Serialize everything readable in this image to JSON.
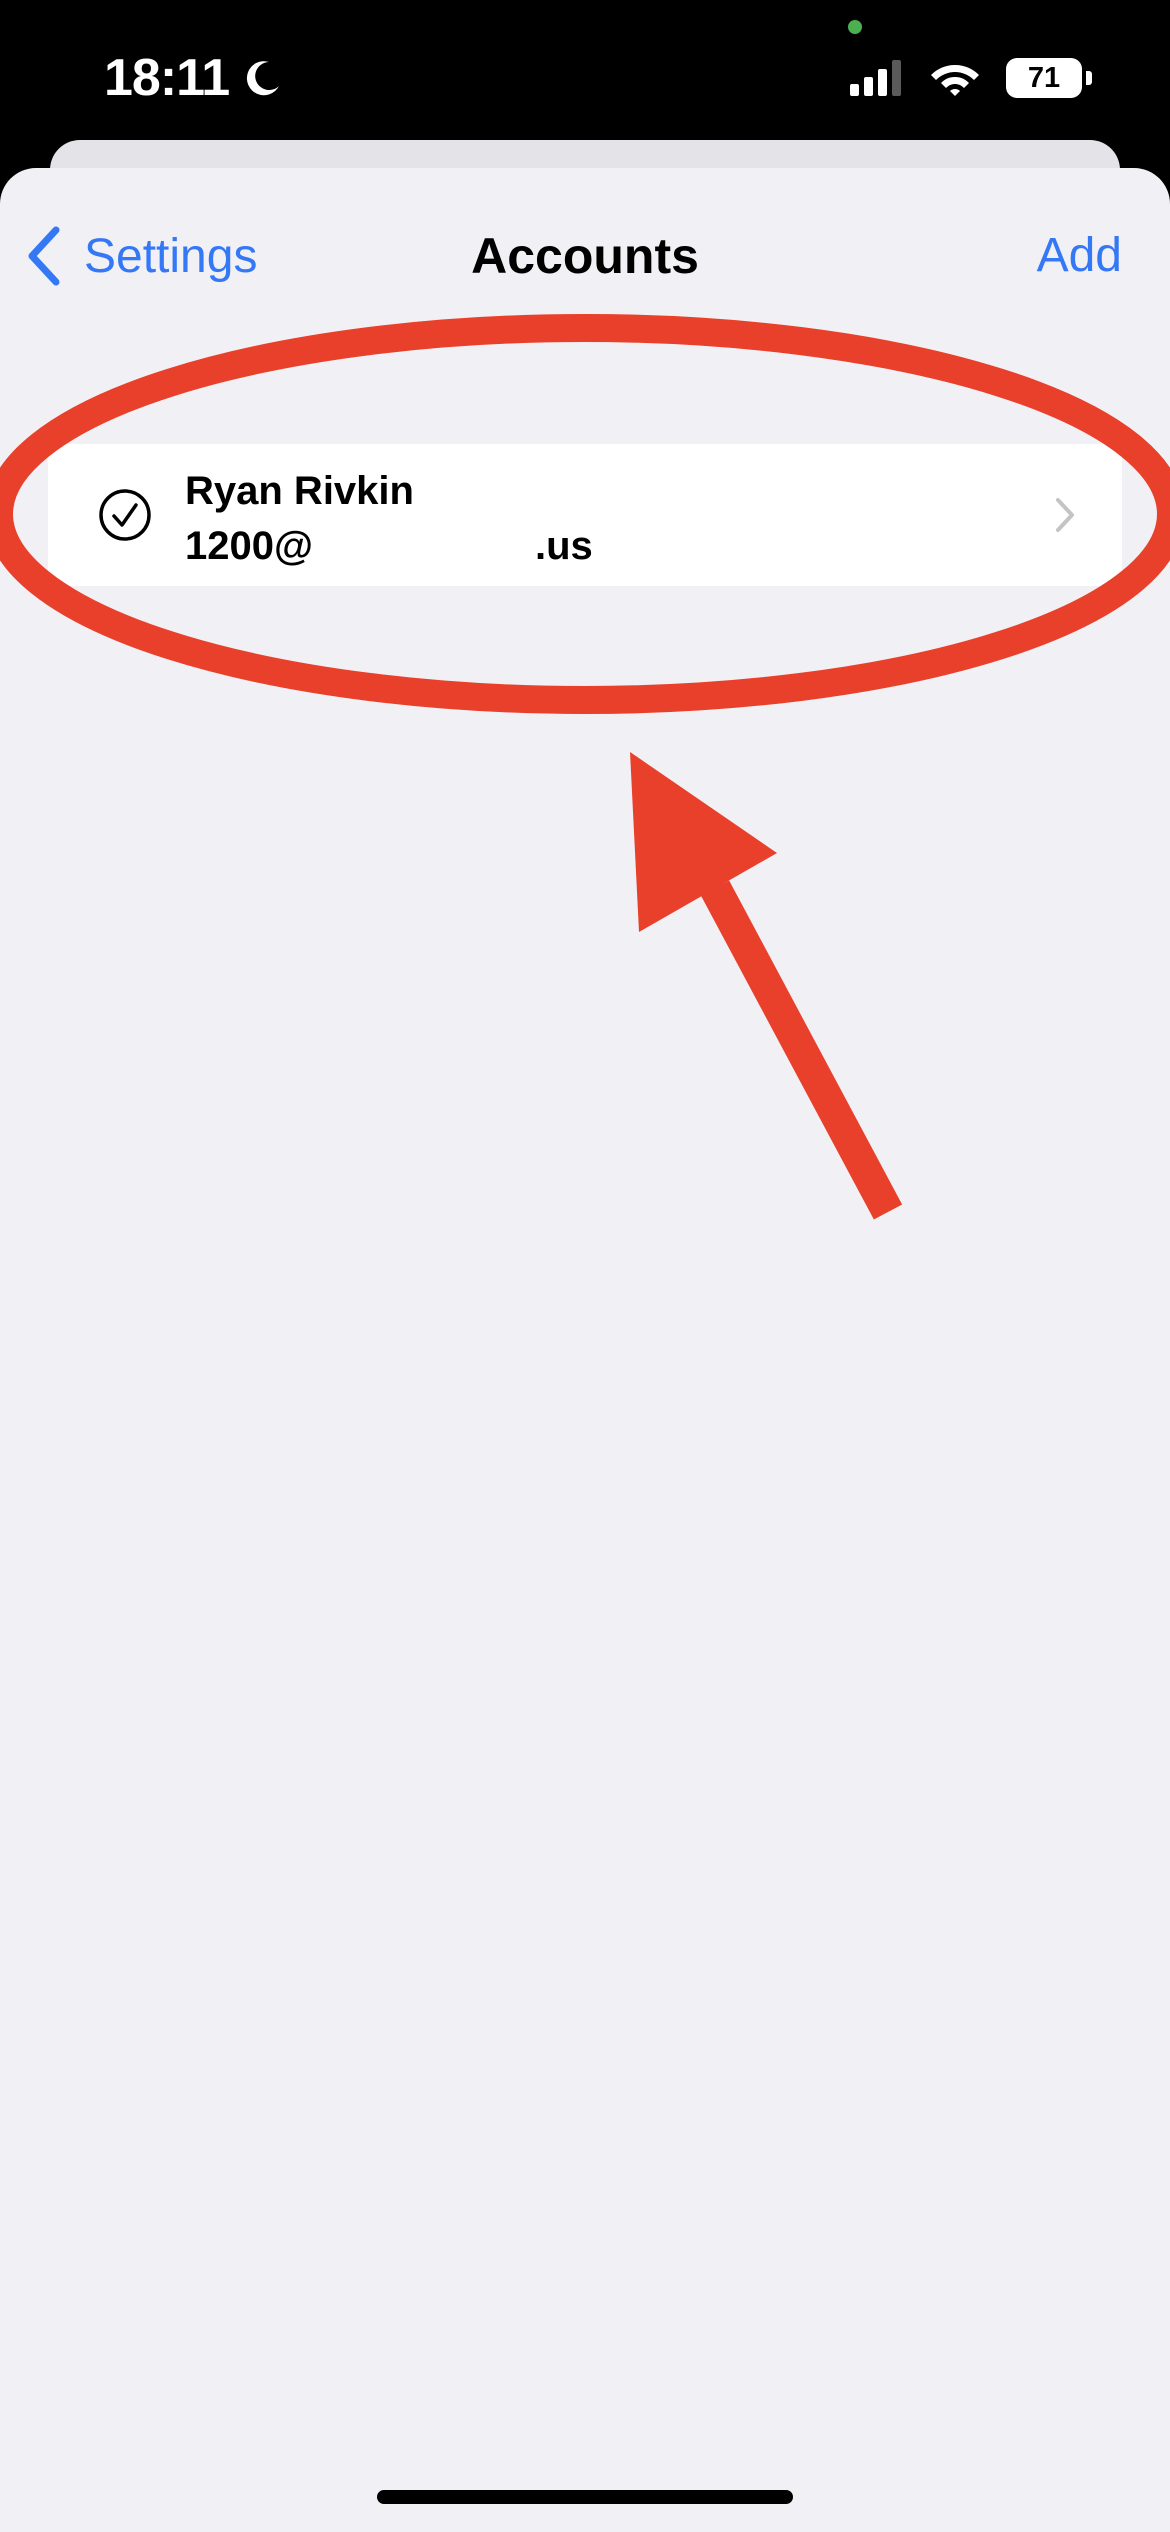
{
  "status_bar": {
    "time": "18:11",
    "focus_icon": "moon-icon",
    "battery_level": "71",
    "icons": [
      "cellular-signal-icon",
      "wifi-icon",
      "battery-icon"
    ],
    "privacy_indicator_color": "#4caf50"
  },
  "nav": {
    "back_label": "Settings",
    "title": "Accounts",
    "add_label": "Add",
    "tint_color": "#3478f6"
  },
  "accounts": [
    {
      "name": "Ryan Rivkin",
      "email_visible_start": "1200@",
      "email_visible_end": ".us",
      "selected": true,
      "icons": [
        "check-circle-icon",
        "chevron-right-icon"
      ]
    }
  ],
  "annotation": {
    "shape": "ellipse-and-arrow",
    "color": "#e8402a"
  }
}
